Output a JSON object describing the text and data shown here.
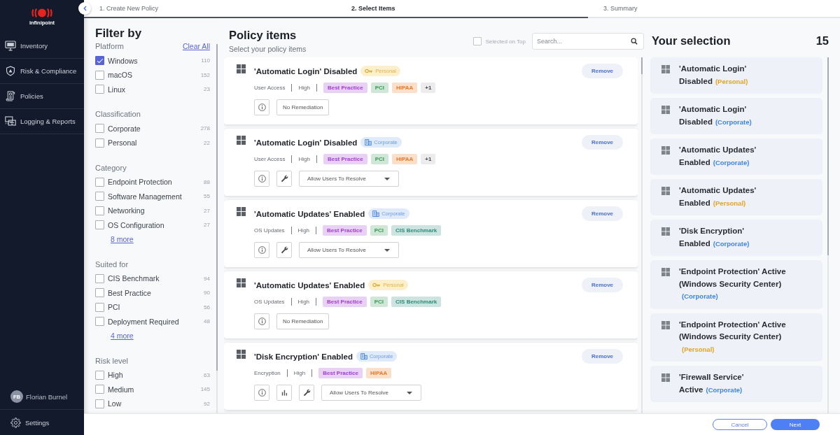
{
  "sidebar": {
    "logo": {
      "text": "infinipoint"
    },
    "items": [
      {
        "label": "Inventory",
        "selected": false
      },
      {
        "label": "Risk & Compliance",
        "selected": false
      },
      {
        "label": "Policies",
        "selected": false
      },
      {
        "label": "Logging & Reports",
        "selected": false
      }
    ],
    "user": {
      "initials": "FB",
      "name": "Florian Burnel"
    },
    "settings": {
      "label": "Settings"
    }
  },
  "steps": [
    {
      "label": "1. Create New Policy",
      "selected": false,
      "done": true
    },
    {
      "label": "2. Select Items",
      "selected": true,
      "done": true
    },
    {
      "label": "3. Summary",
      "selected": false,
      "done": false
    }
  ],
  "filters": {
    "title": "Filter by",
    "sections": [
      {
        "title": "Platform",
        "action": "Clear All",
        "items": [
          {
            "label": "Windows",
            "count": "110",
            "checked": true
          },
          {
            "label": "macOS",
            "count": "152",
            "checked": false
          },
          {
            "label": "Linux",
            "count": "23",
            "checked": false
          }
        ]
      },
      {
        "title": "Classification",
        "items": [
          {
            "label": "Corporate",
            "count": "278",
            "checked": false
          },
          {
            "label": "Personal",
            "count": "22",
            "checked": false
          }
        ]
      },
      {
        "title": "Category",
        "items": [
          {
            "label": "Endpoint Protection",
            "count": "88",
            "checked": false
          },
          {
            "label": "Software Management",
            "count": "55",
            "checked": false
          },
          {
            "label": "Networking",
            "count": "27",
            "checked": false
          },
          {
            "label": "OS Configuration",
            "count": "27",
            "checked": false
          }
        ],
        "more": "8 more"
      },
      {
        "title": "Suited for",
        "items": [
          {
            "label": "CIS Benchmark",
            "count": "94",
            "checked": false
          },
          {
            "label": "Best Practice",
            "count": "90",
            "checked": false
          },
          {
            "label": "PCI",
            "count": "56",
            "checked": false
          },
          {
            "label": "Deployment Required",
            "count": "48",
            "checked": false
          }
        ],
        "more": "4 more"
      },
      {
        "title": "Risk level",
        "items": [
          {
            "label": "High",
            "count": "63",
            "checked": false
          },
          {
            "label": "Medium",
            "count": "145",
            "checked": false
          },
          {
            "label": "Low",
            "count": "92",
            "checked": false
          }
        ]
      }
    ]
  },
  "policy_items": {
    "title": "Policy items",
    "subtitle": "Select your policy items",
    "selected_on_top": {
      "label": "Selected on Top",
      "checked": false
    },
    "search": {
      "placeholder": "Search..."
    },
    "cards": [
      {
        "title": "'Automatic Login' Disabled",
        "badge": {
          "label": "Personal",
          "kind": "personal"
        },
        "category": "User Access",
        "risk": "High",
        "tags": [
          {
            "label": "Best Practice",
            "color": "#a03ed4"
          },
          {
            "label": "PCI",
            "color": "#3b9a58"
          },
          {
            "label": "HIPAA",
            "color": "#ec7a28"
          }
        ],
        "more_tags": "+1",
        "tools": [
          {
            "kind": "info"
          }
        ],
        "remediation": {
          "kind": "button",
          "label": "No Remediation"
        },
        "remove": "Remove"
      },
      {
        "title": "'Automatic Login' Disabled",
        "badge": {
          "label": "Corporate",
          "kind": "corporate"
        },
        "category": "User Access",
        "risk": "High",
        "tags": [
          {
            "label": "Best Practice",
            "color": "#a03ed4"
          },
          {
            "label": "PCI",
            "color": "#3b9a58"
          },
          {
            "label": "HIPAA",
            "color": "#ec7a28"
          }
        ],
        "more_tags": "+1",
        "tools": [
          {
            "kind": "info"
          },
          {
            "kind": "wrench"
          }
        ],
        "remediation": {
          "kind": "dropdown",
          "value": "Allow Users To Resolve"
        },
        "remove": "Remove"
      },
      {
        "title": "'Automatic Updates' Enabled",
        "badge": {
          "label": "Corporate",
          "kind": "corporate"
        },
        "category": "OS Updates",
        "risk": "High",
        "tags": [
          {
            "label": "Best Practice",
            "color": "#a03ed4"
          },
          {
            "label": "PCI",
            "color": "#3b9a58"
          },
          {
            "label": "CIS Benchmark",
            "color": "#2c8c7c"
          }
        ],
        "tools": [
          {
            "kind": "info"
          },
          {
            "kind": "wrench"
          }
        ],
        "remediation": {
          "kind": "dropdown",
          "value": "Allow Users To Resolve"
        },
        "remove": "Remove"
      },
      {
        "title": "'Automatic Updates' Enabled",
        "badge": {
          "label": "Personal",
          "kind": "personal"
        },
        "category": "OS Updates",
        "risk": "High",
        "tags": [
          {
            "label": "Best Practice",
            "color": "#a03ed4"
          },
          {
            "label": "PCI",
            "color": "#3b9a58"
          },
          {
            "label": "CIS Benchmark",
            "color": "#2c8c7c"
          }
        ],
        "tools": [
          {
            "kind": "info"
          }
        ],
        "remediation": {
          "kind": "button",
          "label": "No Remediation"
        },
        "remove": "Remove"
      },
      {
        "title": "'Disk Encryption' Enabled",
        "badge": {
          "label": "Corporate",
          "kind": "corporate"
        },
        "category": "Encryption",
        "risk": "High",
        "tags": [
          {
            "label": "Best Practice",
            "color": "#a03ed4"
          },
          {
            "label": "HIPAA",
            "color": "#ec7a28"
          }
        ],
        "tools": [
          {
            "kind": "info"
          },
          {
            "kind": "chart"
          },
          {
            "kind": "wrench"
          }
        ],
        "remediation": {
          "kind": "dropdown",
          "value": "Allow Users To Resolve"
        },
        "remove": "Remove"
      }
    ]
  },
  "selection": {
    "title": "Your selection",
    "count": "15",
    "items": [
      {
        "title_lines": [
          "'Automatic Login'",
          "Disabled"
        ],
        "classification": "(Personal)",
        "color": "#e6a521"
      },
      {
        "title_lines": [
          "'Automatic Login'",
          "Disabled"
        ],
        "classification": "(Corporate)",
        "color": "#3d85e6"
      },
      {
        "title_lines": [
          "'Automatic Updates'",
          "Enabled"
        ],
        "classification": "(Corporate)",
        "color": "#3d85e6"
      },
      {
        "title_lines": [
          "'Automatic Updates'",
          "Enabled"
        ],
        "classification": "(Personal)",
        "color": "#e6a521"
      },
      {
        "title_lines": [
          "'Disk Encryption'",
          "Enabled"
        ],
        "classification": "(Corporate)",
        "color": "#3d85e6"
      },
      {
        "title_lines": [
          "'Endpoint Protection' Active",
          "(Windows Security Center)"
        ],
        "classification": "(Corporate)",
        "color": "#3d85e6"
      },
      {
        "title_lines": [
          "'Endpoint Protection' Active",
          "(Windows Security Center)"
        ],
        "classification": "(Personal)",
        "color": "#e6a521"
      },
      {
        "title_lines": [
          "'Firewall Service'",
          "Active"
        ],
        "classification": "(Corporate)",
        "color": "#3d85e6"
      }
    ]
  },
  "footer": {
    "cancel": "Cancel",
    "next": "Next"
  }
}
